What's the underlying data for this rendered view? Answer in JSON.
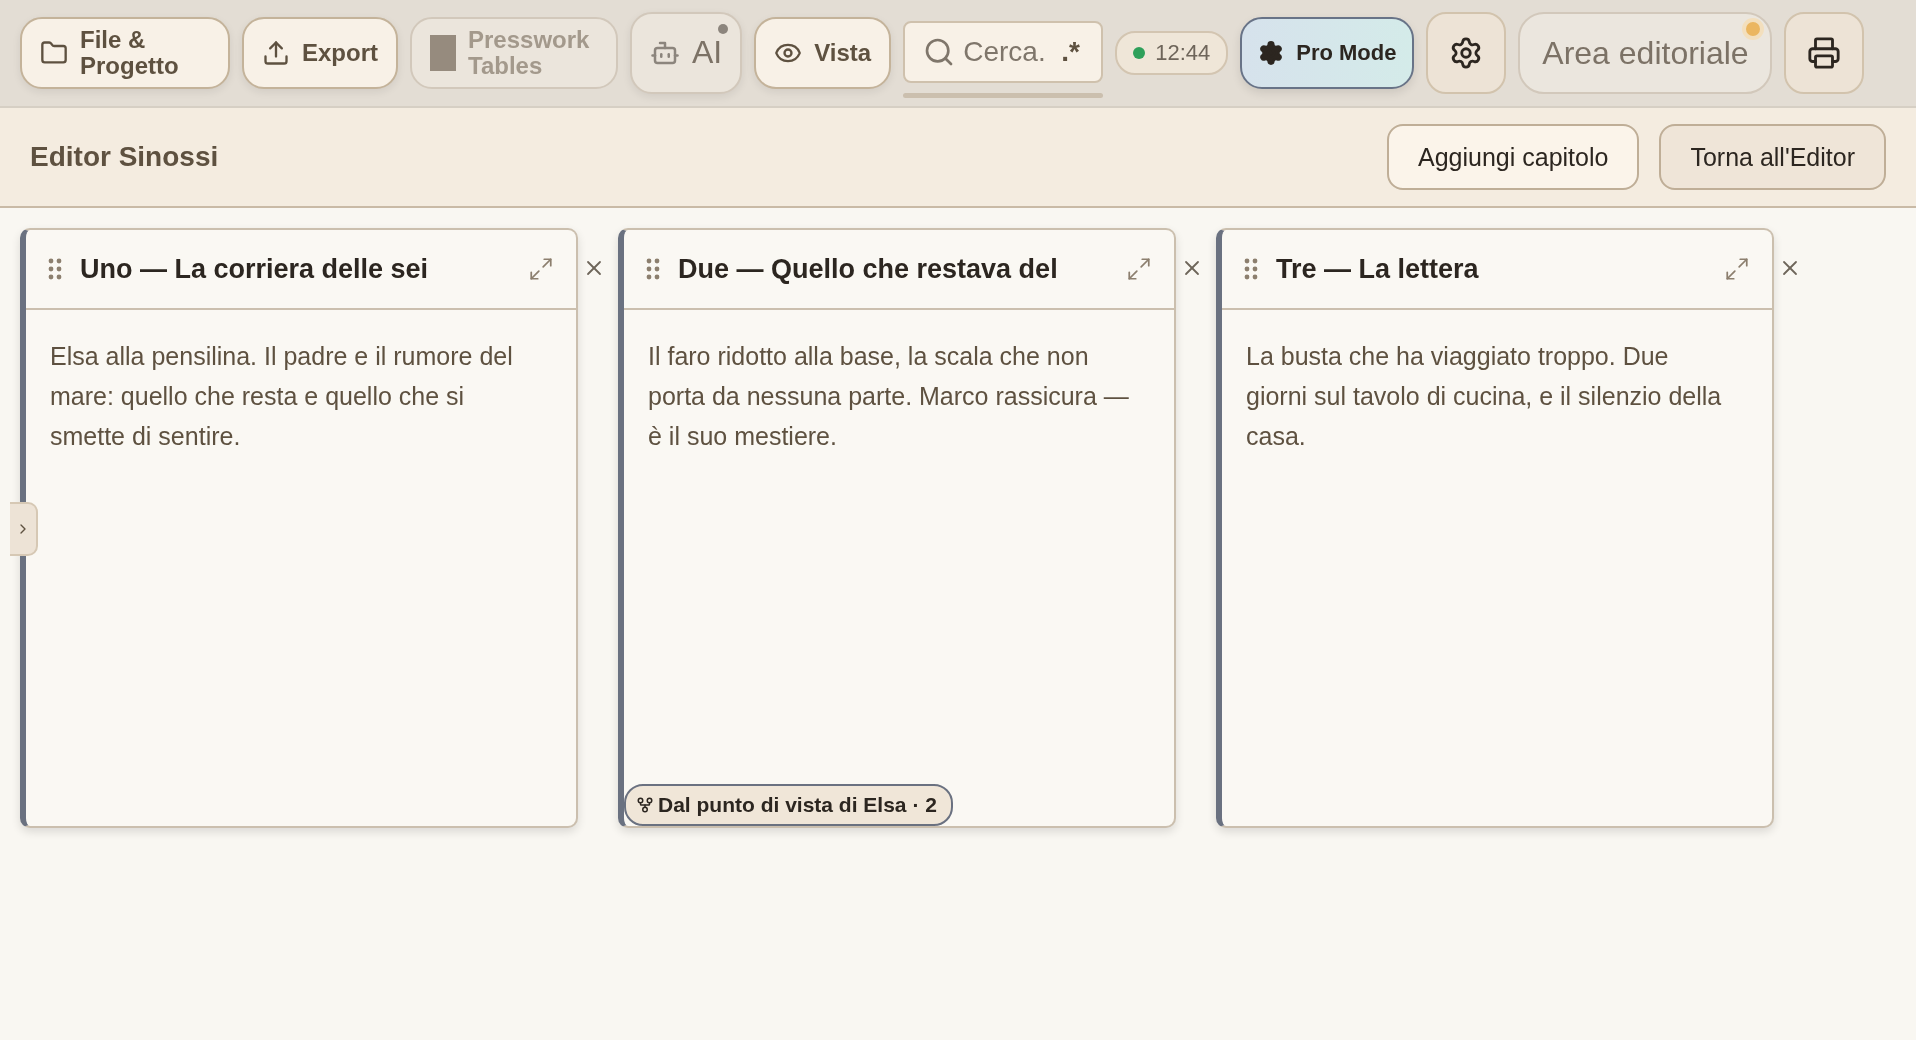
{
  "toolbar": {
    "items": [
      {
        "kind": "button",
        "label": "File & Progetto",
        "disabled": false
      },
      {
        "kind": "button",
        "label": "Export",
        "disabled": false
      },
      {
        "kind": "button",
        "label": "Presswork Tables",
        "disabled": true
      },
      {
        "kind": "button",
        "label": "AI",
        "disabled": false,
        "notification": true
      },
      {
        "kind": "button",
        "label": "Vista",
        "disabled": false
      }
    ],
    "search": {
      "placeholder": "Cerca.",
      "regex_toggle": ".*"
    },
    "clock": {
      "time": "12:44",
      "online": true
    },
    "pro_mode": {
      "label": "Pro Mode",
      "on": true
    },
    "area": {
      "label": "Area editoriale",
      "notification": true
    }
  },
  "header": {
    "title": "Editor Sinossi",
    "buttons": [
      {
        "label": "Aggiungi capitolo",
        "primary": true
      },
      {
        "label": "Torna all'Editor",
        "primary": false
      }
    ]
  },
  "cards": [
    {
      "title": "Uno — La corriera delle sei",
      "text": "Elsa alla pensilina. Il padre e il rumore del mare: quello che resta e quello che si smette di sentire."
    },
    {
      "title": "Due — Quello che restava del",
      "text": "Il faro ridotto alla base, la scala che non porta da nessuna parte. Marco rassicura — è il suo mestiere.",
      "branch": "Dal punto di vista di Elsa · 2"
    },
    {
      "title": "Tre — La lettera",
      "text": "La busta che ha viaggiato troppo. Due giorni sul tavolo di cucina, e il silenzio della casa."
    }
  ]
}
